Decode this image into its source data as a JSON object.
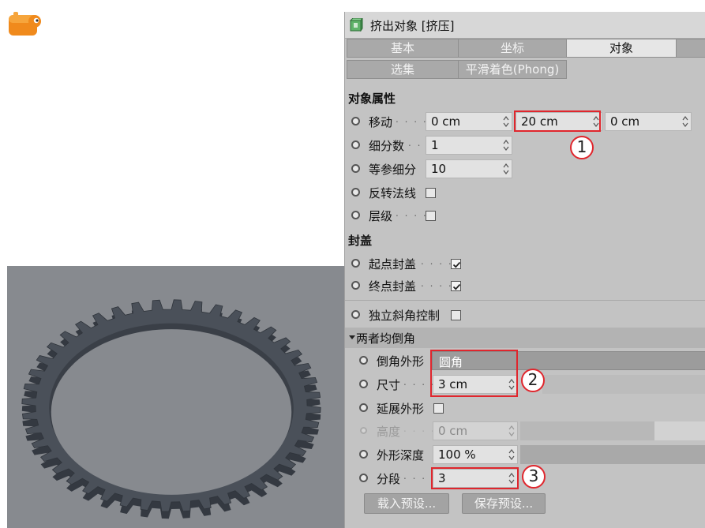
{
  "panel": {
    "title": "挤出对象 [挤压]",
    "tabs_row1": [
      "基本",
      "坐标",
      "对象"
    ],
    "tabs_row2": [
      "选集",
      "平滑着色(Phong)"
    ],
    "active_tab": "对象"
  },
  "object_props": {
    "heading": "对象属性",
    "move": {
      "label": "移动",
      "dots": ". . . .",
      "x": "0 cm",
      "y": "20 cm",
      "z": "0 cm"
    },
    "subdivisions": {
      "label": "细分数",
      "dots": ". .",
      "value": "1"
    },
    "iso_subdivisions": {
      "label": "等参细分",
      "value": "10"
    },
    "flip_normals": {
      "label": "反转法线",
      "checked": false
    },
    "hierarchical": {
      "label": "层级",
      "dots": ". . . . .",
      "checked": false
    }
  },
  "caps": {
    "heading": "封盖",
    "start_cap": {
      "label": "起点封盖",
      "dots": ". . . .",
      "checked": true
    },
    "end_cap": {
      "label": "终点封盖",
      "dots": ". . . .",
      "checked": true
    }
  },
  "bevel": {
    "independent": {
      "label": "独立斜角控制",
      "checked": false
    },
    "subheading": "两者均倒角",
    "shape": {
      "label": "倒角外形",
      "value": "圆角"
    },
    "size": {
      "label": "尺寸",
      "dots": ". . . .",
      "value": "3 cm"
    },
    "extend_shape": {
      "label": "延展外形",
      "checked": false
    },
    "height": {
      "label": "高度",
      "dots": ". . . .",
      "value": "0 cm"
    },
    "shape_depth": {
      "label": "外形深度",
      "value": "100 %"
    },
    "segments": {
      "label": "分段",
      "dots": ". . . .",
      "value": "3"
    }
  },
  "buttons": {
    "load_preset": "载入预设...",
    "save_preset": "保存预设..."
  },
  "annotations": [
    "1",
    "2",
    "3"
  ],
  "colors": {
    "highlight": "#e0262d",
    "viewport_bg": "#878a8f",
    "gear": "#4a5059"
  }
}
